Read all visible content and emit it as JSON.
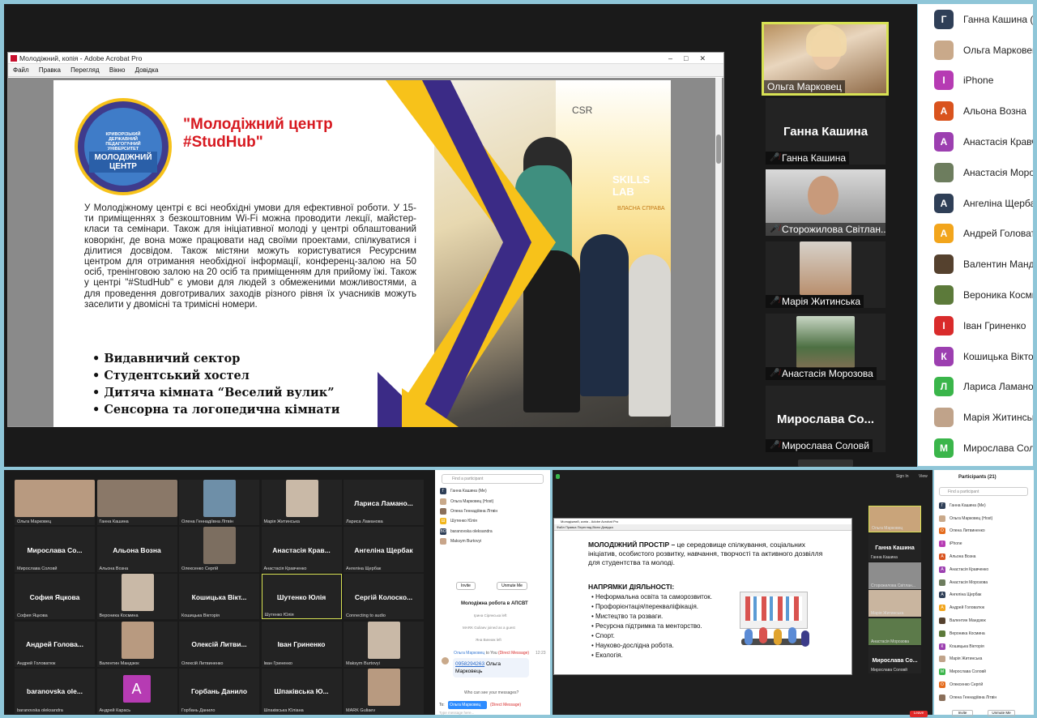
{
  "acrobat": {
    "title": "Молодіжний, копія - Adobe Acrobat Pro",
    "menu": [
      "Файл",
      "Правка",
      "Перегляд",
      "Вікно",
      "Довідка"
    ]
  },
  "slide": {
    "logo_top": "МІНІСТЕРСТВО ОСВІТИ І НАУКИ УКРАЇНИ",
    "logo_uni": "КРИВОРІЗЬКИЙ ДЕРЖАВНИЙ ПЕДАГОГІЧНИЙ УНІВЕРСИТЕТ",
    "logo_center": "МОЛОДІЖНИЙ ЦЕНТР",
    "title": "\"Молодіжний центр #StudHub\"",
    "body": "У Молодіжному центрі є всі необхідні умови для ефективної роботи. У 15-ти приміщеннях з безкоштовним Wi-Fi можна проводити лекції, майстер-класи та семінари. Також для ініціативної молоді у центрі облаштований коворкінг, де вона може працювати над своїми проектами, спілкуватися і ділитися досвідом. Також містяни можуть користуватися Ресурсним центром для отримання необхідної інформації, конференц-залою на 50 осіб, тренінговою залою на 20 осіб та приміщенням для прийому їжі. Також у центрі \"#StudHub\" є умови для людей з обмеженими можливостями, а для проведення довготривалих заходів різного рівня їх учасників можуть заселити у двомісні та тримісні номери.",
    "bullets": [
      "Видавничий сектор",
      "Студентський хостел",
      "Дитяча кімната “Веселий вулик”",
      "Сенсорна та логопедична кімнати"
    ],
    "banner_csr": "CSR",
    "banner_skills": "SKILLS LAB",
    "banner_sub": "ВЛАСНА СПРАВА"
  },
  "videos": [
    {
      "name": "Ольга Марковец",
      "big": "",
      "muted": false
    },
    {
      "name": "Ганна Кашина",
      "big": "Ганна Кашина",
      "muted": true
    },
    {
      "name": "Сторожилова Світлан...",
      "big": "",
      "muted": true
    },
    {
      "name": "Марія Житинська",
      "big": "",
      "muted": true
    },
    {
      "name": "Анастасія Морозова",
      "big": "",
      "muted": true
    },
    {
      "name": "Мирослава Соловй",
      "big": "Мирослава Со...",
      "muted": true
    }
  ],
  "participants": [
    {
      "initial": "Г",
      "name": "Ганна Кашина (Me)",
      "color": "#2f3f57"
    },
    {
      "initial": "",
      "name": "Ольга Марковец (Host)",
      "color": "#c9a98a"
    },
    {
      "initial": "I",
      "name": "iPhone",
      "color": "#b63bb3"
    },
    {
      "initial": "А",
      "name": "Альона Возна",
      "color": "#d9531e"
    },
    {
      "initial": "А",
      "name": "Анастасія Кравченко",
      "color": "#9c3fb0"
    },
    {
      "initial": "",
      "name": "Анастасія Морозова",
      "color": "#6d7d5e"
    },
    {
      "initial": "А",
      "name": "Ангеліна Щербак",
      "color": "#2f3f57"
    },
    {
      "initial": "А",
      "name": "Андрей Головатюк",
      "color": "#f2a51c"
    },
    {
      "initial": "",
      "name": "Валентин Мандзюк",
      "color": "#55412e"
    },
    {
      "initial": "",
      "name": "Вероника Космина",
      "color": "#5c7a3a"
    },
    {
      "initial": "I",
      "name": "Іван Гриненко",
      "color": "#d92b2b"
    },
    {
      "initial": "К",
      "name": "Кошицька Вікторія",
      "color": "#9c3fb0"
    },
    {
      "initial": "Л",
      "name": "Лариса Ламанова",
      "color": "#3ab54a"
    },
    {
      "initial": "",
      "name": "Марія Житинська",
      "color": "#c0a38a"
    },
    {
      "initial": "М",
      "name": "Мирослава Соловй",
      "color": "#3ab54a"
    }
  ],
  "gallery": [
    {
      "name": "Ольга Марковец",
      "big": ""
    },
    {
      "name": "Ганна Кашина",
      "big": ""
    },
    {
      "name": "Олена Геннадіївна Літвін",
      "big": ""
    },
    {
      "name": "Марія Житинська",
      "big": ""
    },
    {
      "name": "Лариса Ламанова",
      "big": "Лариса Ламано..."
    },
    {
      "name": "Мирослава Соловй",
      "big": "Мирослава Со..."
    },
    {
      "name": "Альона Возна",
      "big": "Альона Возна"
    },
    {
      "name": "Олексенко Сергій",
      "big": ""
    },
    {
      "name": "Анастасія Кравченко",
      "big": "Анастасія Крав..."
    },
    {
      "name": "Ангеліна Щербак",
      "big": "Ангеліна Щербак"
    },
    {
      "name": "София Яцкова",
      "big": "София Яцкова"
    },
    {
      "name": "Вероника Космина",
      "big": ""
    },
    {
      "name": "Кошицька Вікторія",
      "big": "Кошицька Вікт..."
    },
    {
      "name": "Шутенко Юлія",
      "big": "Шутенко Юлія"
    },
    {
      "name": "Connecting to audio",
      "big": "Сергій Колоско..."
    },
    {
      "name": "Андрей Головатюк",
      "big": "Андрей Голова..."
    },
    {
      "name": "Валентин Мандзюк",
      "big": ""
    },
    {
      "name": "Олексій Литвиненко",
      "big": "Олексій Литви..."
    },
    {
      "name": "Іван Гриненко",
      "big": "Іван Гриненко"
    },
    {
      "name": "Maksym Burtovyi",
      "big": ""
    },
    {
      "name": "baranovska oleksandra",
      "big": "baranovska ole..."
    },
    {
      "name": "Андрей Карась",
      "big": ""
    },
    {
      "name": "Горбань Данило",
      "big": "Горбань Данило"
    },
    {
      "name": "Шпаківська Юліана",
      "big": "Шпаківська Ю..."
    },
    {
      "name": "MARK Guliaev",
      "big": ""
    }
  ],
  "chat_panel": {
    "search": "Find a participant",
    "people": [
      "Ганна Кашина (Me)",
      "Ольга Марковец (Host)",
      "Олена Геннадіївна Літвін",
      "Шутенко Юлія",
      "baranovska oleksandra",
      "Maksym Burtovyi"
    ],
    "invite": "Invite",
    "unmute": "Unmute Me",
    "chat_title": "Молодіжна робота в АПСВТ",
    "sys": [
      "Ірина Сірянська left",
      "MARK Guliaev joined as a guest",
      "Яна Винник left"
    ],
    "from": "Ольга Марковец",
    "to": "to You",
    "dm": "(Direct Message)",
    "time": "12:23",
    "msg_phone": "0958294263",
    "msg_text": "Ольга Марковець",
    "who": "Who can see your messages?",
    "to_label": "To:",
    "to_sel": "Ольга Марковец",
    "placeholder": "Type message here..."
  },
  "br": {
    "acro_title": "Молодіжний, копія - Adobe Acrobat Pro",
    "menu": "Файл  Правка  Перегляд  Вікно  Довідка",
    "h1": "МОЛОДІЖНИЙ ПРОСТІР –",
    "p1": " це середовище спілкування, соціальних ініціатив, особистого розвитку, навчання, творчості та активного дозвілля для студентства та молоді.",
    "h2": "НАПРЯМКИ ДІЯЛЬНОСТІ:",
    "items": [
      "Неформальна освіта та саморозвиток.",
      "Профорієнтація/перекваліфікація.",
      "Мистецтво та розваги.",
      "Ресурсна підтримка та менторство.",
      "Спорт.",
      "Науково-дослідна робота.",
      "Екологія."
    ],
    "signin": "Sign In",
    "view": "View",
    "vids": [
      {
        "name": "Ольга Марковец",
        "big": ""
      },
      {
        "name": "Ганна Кашина",
        "big": "Ганна Кашина"
      },
      {
        "name": "Сторожилова Світлан...",
        "big": ""
      },
      {
        "name": "Марія Житинська",
        "big": ""
      },
      {
        "name": "Анастасія Морозова",
        "big": ""
      },
      {
        "name": "Мирослава Соловй",
        "big": "Мирослава Со..."
      }
    ],
    "part_title": "Participants (21)",
    "search": "Find a participant",
    "people": [
      [
        "Г",
        "Ганна Кашина (Me)",
        "#2f3f57"
      ],
      [
        "",
        "Ольга Марковец (Host)",
        "#c9a98a"
      ],
      [
        "О",
        "Олена Литвиненко",
        "#e46b1c"
      ],
      [
        "I",
        "iPhone",
        "#b63bb3"
      ],
      [
        "А",
        "Альона Возна",
        "#d9531e"
      ],
      [
        "А",
        "Анастасія Кравченко",
        "#9c3fb0"
      ],
      [
        "",
        "Анастасія Морозова",
        "#6d7d5e"
      ],
      [
        "А",
        "Ангеліна Щербак",
        "#2f3f57"
      ],
      [
        "А",
        "Андрей Головатюк",
        "#f2a51c"
      ],
      [
        "",
        "Валентин Мандзюк",
        "#55412e"
      ],
      [
        "",
        "Вероника Космина",
        "#5c7a3a"
      ],
      [
        "К",
        "Кошицька Вікторія",
        "#9c3fb0"
      ],
      [
        "",
        "Марія Житинська",
        "#c0a38a"
      ],
      [
        "М",
        "Мирослава Соловй",
        "#3ab54a"
      ],
      [
        "О",
        "Олексенко Сергій",
        "#e46b1c"
      ],
      [
        "",
        "Олена Геннадіївна Літвін",
        "#8a6f5a"
      ]
    ],
    "invite": "Invite",
    "mute": "Unmute Me",
    "leave": "Leave"
  }
}
